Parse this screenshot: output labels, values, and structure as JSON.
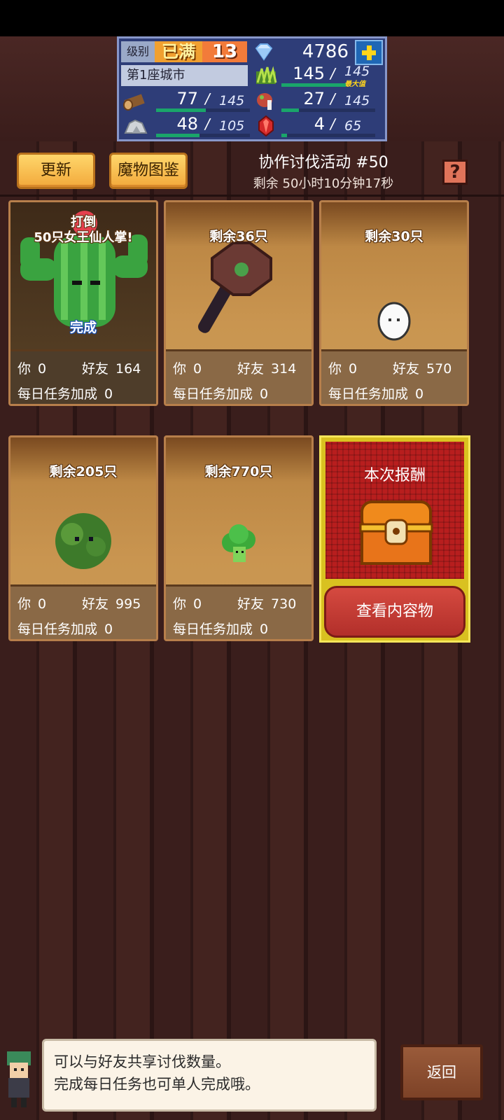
{
  "resources": {
    "level_label": "级别",
    "level_max": "已满",
    "level_value": "13",
    "gems": "4786",
    "city": "第1座城市",
    "food": {
      "value": "145",
      "max": "145",
      "tag": "最大值",
      "fill": 1.0
    },
    "wood": {
      "value": "77",
      "max": "145",
      "fill": 0.53
    },
    "meat": {
      "value": "27",
      "max": "145",
      "fill": 0.19
    },
    "ore": {
      "value": "48",
      "max": "105",
      "fill": 0.46
    },
    "crystal": {
      "value": "4",
      "max": "65",
      "fill": 0.06
    },
    "separator": "/"
  },
  "header": {
    "refresh_label": "更新",
    "bestiary_label": "魔物图鉴",
    "event_title": "协作讨伐活动 #50",
    "event_timer": "剩余 50小时10分钟17秒",
    "help_label": "?"
  },
  "labels": {
    "you": "你",
    "friends": "好友",
    "daily_bonus": "每日任务加成"
  },
  "cards": [
    {
      "title": "打倒\n50只女王仙人掌!",
      "title_line1": "打倒",
      "title_line2": "50只女王仙人掌!",
      "status": "完成",
      "you": "0",
      "friends": "164",
      "bonus": "0"
    },
    {
      "title": "剩余36只",
      "you": "0",
      "friends": "314",
      "bonus": "0"
    },
    {
      "title": "剩余30只",
      "you": "0",
      "friends": "570",
      "bonus": "0"
    },
    {
      "title": "剩余205只",
      "you": "0",
      "friends": "995",
      "bonus": "0"
    },
    {
      "title": "剩余770只",
      "you": "0",
      "friends": "730",
      "bonus": "0"
    }
  ],
  "reward": {
    "title": "本次报酬",
    "button": "查看内容物"
  },
  "dialog": {
    "line1": "可以与好友共享讨伐数量。",
    "line2": "完成每日任务也可单人完成哦。"
  },
  "back_label": "返回"
}
